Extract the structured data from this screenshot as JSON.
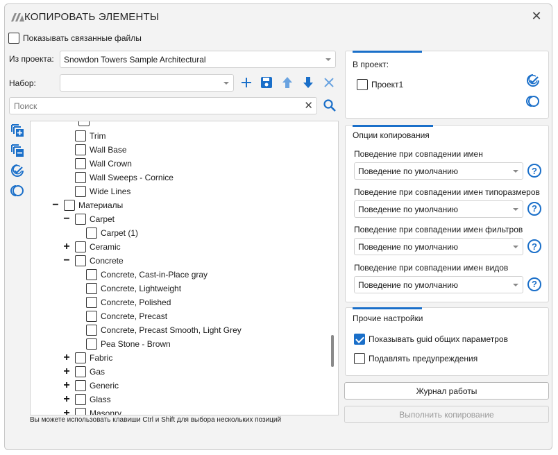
{
  "window": {
    "title": "КОПИРОВАТЬ ЭЛЕМЕНТЫ"
  },
  "show_linked": {
    "label": "Показывать связанные файлы",
    "checked": false
  },
  "source": {
    "label": "Из проекта:",
    "value": "Snowdon Towers Sample Architectural"
  },
  "set": {
    "label": "Набор:",
    "value": ""
  },
  "search": {
    "placeholder": "Поиск"
  },
  "tree": [
    {
      "label": "Trim",
      "level": 2,
      "toggle": "",
      "checked": false
    },
    {
      "label": "Wall Base",
      "level": 2,
      "toggle": "",
      "checked": false
    },
    {
      "label": "Wall Crown",
      "level": 2,
      "toggle": "",
      "checked": false
    },
    {
      "label": "Wall Sweeps - Cornice",
      "level": 2,
      "toggle": "",
      "checked": false
    },
    {
      "label": "Wide Lines",
      "level": 2,
      "toggle": "",
      "checked": false
    },
    {
      "label": "Материалы",
      "level": 1,
      "toggle": "−",
      "checked": false
    },
    {
      "label": "Carpet",
      "level": 2,
      "toggle": "−",
      "checked": false
    },
    {
      "label": "Carpet (1)",
      "level": 3,
      "toggle": "",
      "checked": false
    },
    {
      "label": "Ceramic",
      "level": 2,
      "toggle": "+",
      "checked": false
    },
    {
      "label": "Concrete",
      "level": 2,
      "toggle": "−",
      "checked": false
    },
    {
      "label": "Concrete, Cast-in-Place gray",
      "level": 3,
      "toggle": "",
      "checked": false
    },
    {
      "label": "Concrete, Lightweight",
      "level": 3,
      "toggle": "",
      "checked": false
    },
    {
      "label": "Concrete, Polished",
      "level": 3,
      "toggle": "",
      "checked": false
    },
    {
      "label": "Concrete, Precast",
      "level": 3,
      "toggle": "",
      "checked": false
    },
    {
      "label": "Concrete, Precast Smooth, Light Grey",
      "level": 3,
      "toggle": "",
      "checked": false
    },
    {
      "label": "Pea Stone - Brown",
      "level": 3,
      "toggle": "",
      "checked": false
    },
    {
      "label": "Fabric",
      "level": 2,
      "toggle": "+",
      "checked": false
    },
    {
      "label": "Gas",
      "level": 2,
      "toggle": "+",
      "checked": false
    },
    {
      "label": "Generic",
      "level": 2,
      "toggle": "+",
      "checked": false
    },
    {
      "label": "Glass",
      "level": 2,
      "toggle": "+",
      "checked": false
    },
    {
      "label": "Masonry",
      "level": 2,
      "toggle": "+",
      "checked": false
    }
  ],
  "hint": "Вы можете использовать клавиши Ctrl и Shift для выбора нескольких позиций",
  "target": {
    "title": "В проект:",
    "project": "Проект1"
  },
  "copy_options": {
    "title": "Опции копирования",
    "groups": [
      {
        "label": "Поведение при совпадении имен",
        "value": "Поведение по умолчанию"
      },
      {
        "label": "Поведение при совпадении имен типоразмеров",
        "value": "Поведение по умолчанию"
      },
      {
        "label": "Поведение при совпадении имен фильтров",
        "value": "Поведение по умолчанию"
      },
      {
        "label": "Поведение при совпадении имен видов",
        "value": "Поведение по умолчанию"
      }
    ]
  },
  "other": {
    "title": "Прочие настройки",
    "show_guid": {
      "label": "Показывать guid общих параметров",
      "checked": true
    },
    "suppress": {
      "label": "Подавлять предупреждения",
      "checked": false
    }
  },
  "buttons": {
    "log": "Журнал работы",
    "run": "Выполнить копирование"
  },
  "colors": {
    "accent": "#1a6fc9",
    "background": "#f3f3f3"
  }
}
